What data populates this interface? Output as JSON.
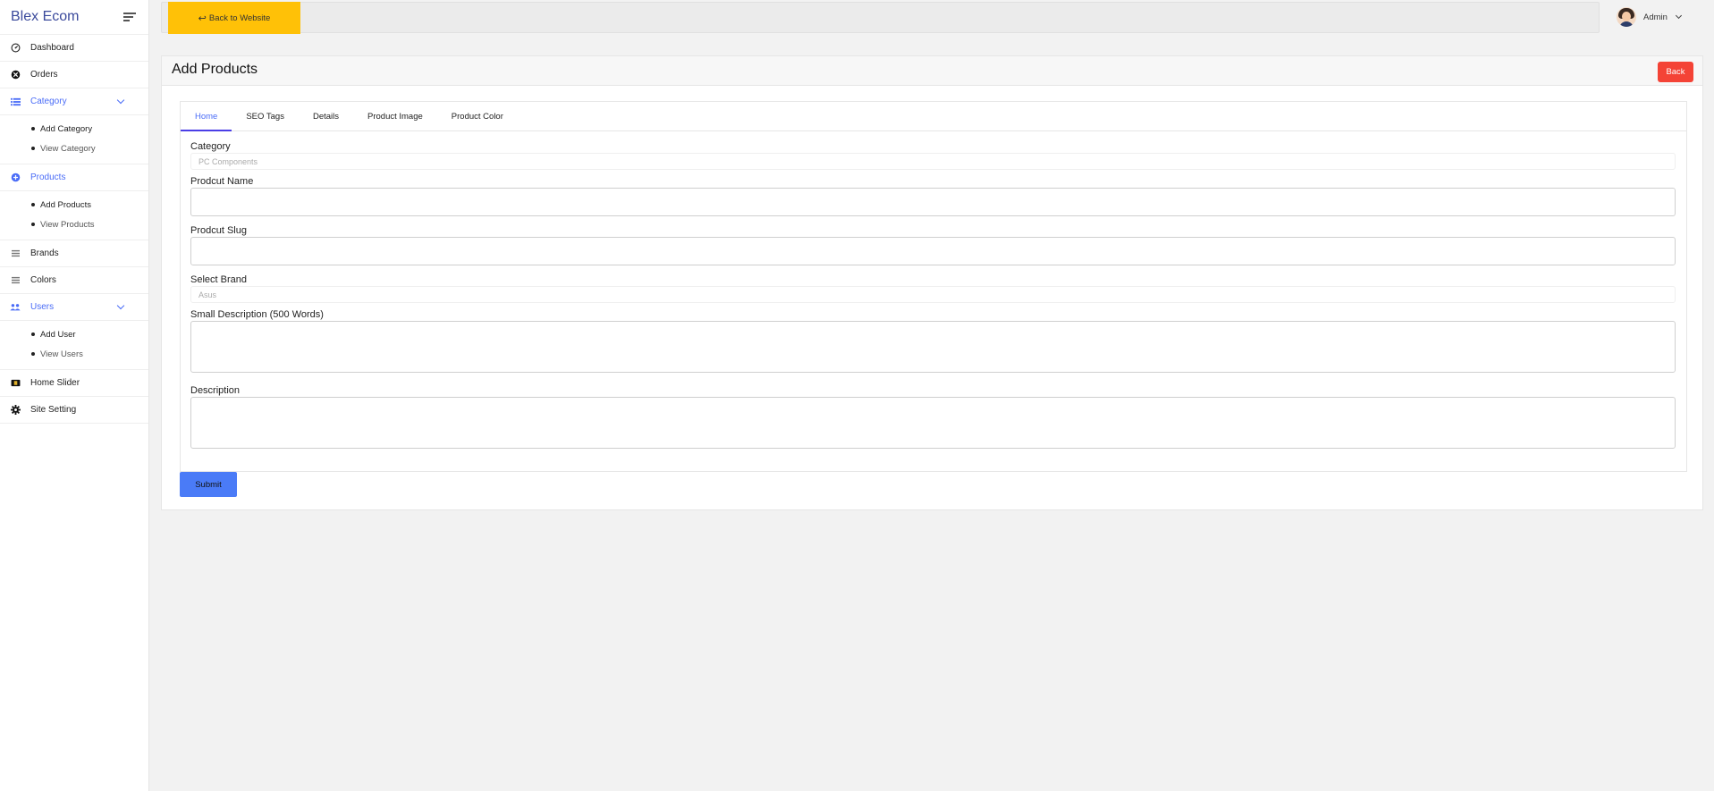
{
  "sidebar": {
    "brand": "Blex Ecom",
    "items": [
      {
        "label": "Dashboard",
        "icon": "gauge-icon"
      },
      {
        "label": "Orders",
        "icon": "orders-icon"
      },
      {
        "label": "Category",
        "icon": "list-icon",
        "expanded": true,
        "sub": [
          "Add Category",
          "View Category"
        ]
      },
      {
        "label": "Products",
        "icon": "plus-circle-icon",
        "expanded": true,
        "sub": [
          "Add Products",
          "View Products"
        ]
      },
      {
        "label": "Brands",
        "icon": "bars-icon"
      },
      {
        "label": "Colors",
        "icon": "bars-icon"
      },
      {
        "label": "Users",
        "icon": "users-icon",
        "expanded": true,
        "sub": [
          "Add User",
          "View Users"
        ]
      },
      {
        "label": "Home Slider",
        "icon": "film-icon"
      },
      {
        "label": "Site Setting",
        "icon": "gear-icon"
      }
    ]
  },
  "topbar": {
    "back_to_website": "Back to Website",
    "user_name": "Admin"
  },
  "page": {
    "title": "Add Products",
    "back_label": "Back",
    "tabs": [
      "Home",
      "SEO Tags",
      "Details",
      "Product Image",
      "Product Color"
    ],
    "active_tab": "Home",
    "form": {
      "category_label": "Category",
      "category_value": "PC Components",
      "name_label": "Prodcut Name",
      "name_value": "",
      "slug_label": "Prodcut Slug",
      "slug_value": "",
      "brand_label": "Select Brand",
      "brand_value": "Asus",
      "small_desc_label": "Small Description (500 Words)",
      "desc_label": "Description"
    },
    "submit_label": "Submit"
  },
  "colors": {
    "accent": "#4a6cf7",
    "back_to_website_bg": "#ffc107",
    "back_btn_bg": "#f44336",
    "submit_bg": "#4a7bf7"
  }
}
